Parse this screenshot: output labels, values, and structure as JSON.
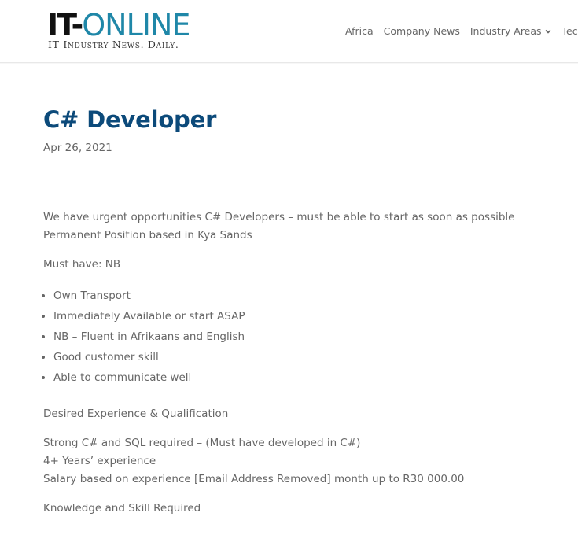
{
  "header": {
    "logo": {
      "text_it": "IT-",
      "text_online": "ONLINE",
      "tagline": "IT Industry News. Daily."
    },
    "nav": {
      "items": [
        {
          "label": "Africa",
          "has_dropdown": false
        },
        {
          "label": "Company News",
          "has_dropdown": false
        },
        {
          "label": "Industry Areas",
          "has_dropdown": true
        },
        {
          "label": "Tech",
          "has_dropdown": false
        }
      ]
    }
  },
  "post": {
    "title": "C# Developer",
    "date": "Apr 26, 2021",
    "intro_line_1": "We have urgent opportunities C# Developers – must be able to start as soon as possible",
    "intro_line_2": "Permanent Position based in Kya Sands",
    "must_have": "Must have: NB",
    "requirements": [
      "Own Transport",
      "Immediately Available or start ASAP",
      "NB – Fluent in Afrikaans and English",
      "Good customer skill",
      "Able to communicate well"
    ],
    "desired_heading": "Desired Experience & Qualification",
    "desired_line_1": "Strong C# and SQL required – (Must have developed in C#)",
    "desired_line_2": "4+ Years’ experience",
    "desired_line_3": "Salary based on experience [Email Address Removed] month up to R30 000.00",
    "knowledge_heading": "Knowledge and Skill Required"
  },
  "colors": {
    "title": "#0c4a7a",
    "logo_accent": "#1f87a8",
    "body_text": "#666666"
  }
}
